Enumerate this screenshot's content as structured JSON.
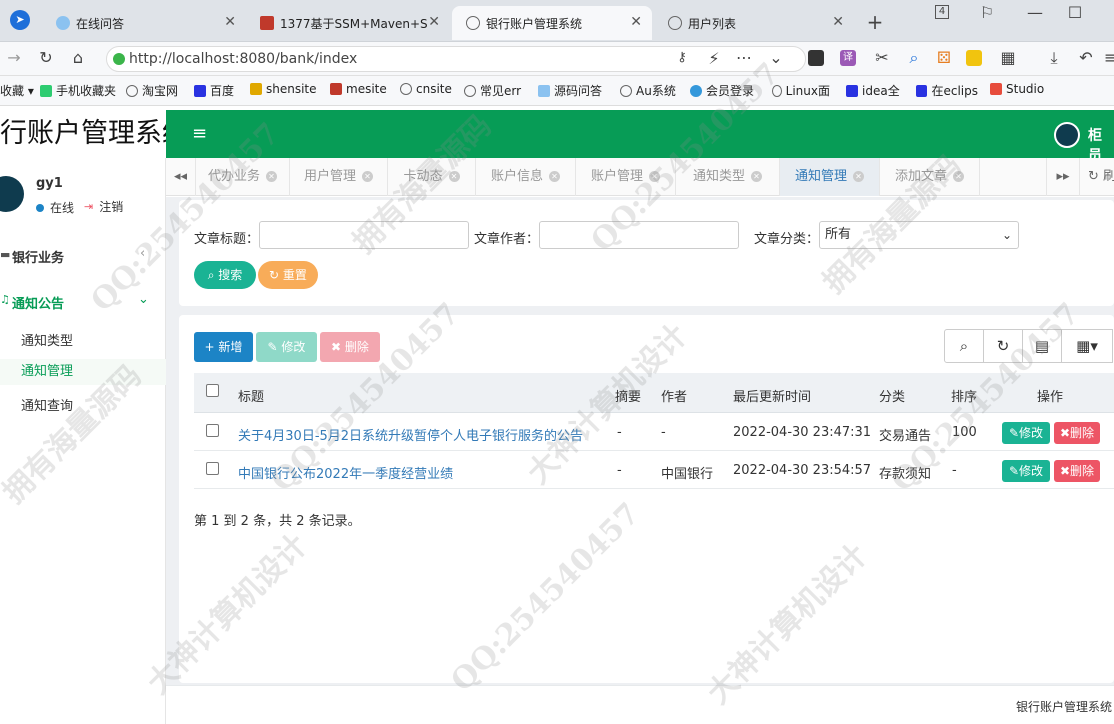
{
  "browser": {
    "tabs": [
      {
        "title": "在线问答",
        "active": false
      },
      {
        "title": "1377基于SSM+Maven+S",
        "active": false
      },
      {
        "title": "银行账户管理系统",
        "active": true
      },
      {
        "title": "用户列表",
        "active": false
      }
    ],
    "tab_count": "4",
    "url": "http://localhost:8080/bank/index",
    "bookmarks": [
      "收藏",
      "手机收藏夹",
      "淘宝网",
      "百度",
      "shensite",
      "mesite",
      "cnsite",
      "常见err",
      "源码问答",
      "Au系统",
      "会员登录",
      "Linux面",
      "idea全",
      "在eclips",
      "Studio"
    ]
  },
  "app": {
    "logo_text": "行账户管理系统",
    "header_user": "柜员",
    "user": {
      "name": "gy1",
      "status": "在线",
      "logout": "注销"
    },
    "menu": {
      "group1": "银行业务",
      "group2": "通知公告",
      "items": [
        "通知类型",
        "通知管理",
        "通知查询"
      ],
      "active_item": "通知管理"
    },
    "page_tabs": [
      "代办业务",
      "用户管理",
      "卡动态",
      "账户信息",
      "账户管理",
      "通知类型",
      "通知管理",
      "添加文章"
    ],
    "active_page_tab": "通知管理",
    "refresh_label": "刷"
  },
  "search": {
    "title_label": "文章标题：",
    "author_label": "文章作者：",
    "category_label": "文章分类：",
    "category_value": "所有",
    "search_button": "搜索",
    "reset_button": "重置"
  },
  "toolbar": {
    "add": "新增",
    "edit": "修改",
    "delete": "删除"
  },
  "table": {
    "columns": [
      "标题",
      "摘要",
      "作者",
      "最后更新时间",
      "分类",
      "排序",
      "操作"
    ],
    "rows": [
      {
        "title": "关于4月30日-5月2日系统升级暂停个人电子银行服务的公告",
        "summary": "-",
        "author": "-",
        "updated": "2022-04-30 23:47:31",
        "category": "交易通告",
        "order": "100",
        "edit": "修改",
        "delete": "删除"
      },
      {
        "title": "中国银行公布2022年一季度经营业绩",
        "summary": "-",
        "author": "中国银行",
        "updated": "2022-04-30 23:54:57",
        "category": "存款须知",
        "order": "-",
        "edit": "修改",
        "delete": "删除"
      }
    ],
    "footer": "第 1 到 2 条，共 2 条记录。"
  },
  "footer_text": "银行账户管理系统",
  "watermarks": [
    "QQ:254540457",
    "拥有海量源码",
    "大神计算机设计"
  ],
  "colors": {
    "header": "#079c56",
    "primary": "#1c84c6",
    "success": "#1ab394",
    "warning": "#f8ac59",
    "danger": "#ed5565",
    "link": "#337ab7"
  }
}
